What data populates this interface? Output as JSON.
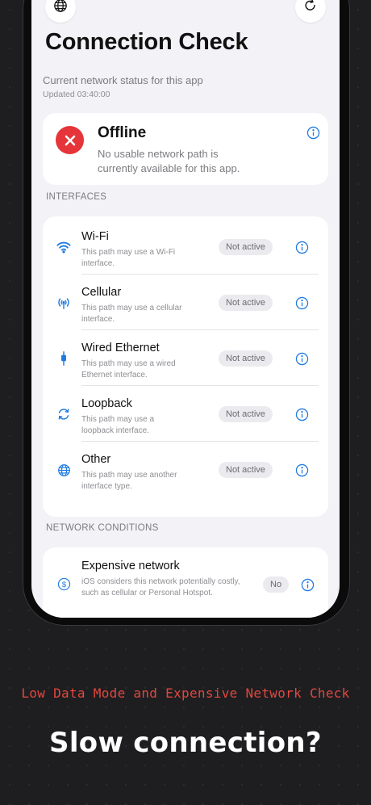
{
  "header": {
    "title": "Connection Check",
    "subtitle": "Current network status for this app",
    "updated": "Updated 03:40:00",
    "left_icon": "globe-icon",
    "right_icon": "refresh-icon"
  },
  "status": {
    "title": "Offline",
    "description": "No usable network path is currently available for this app.",
    "icon": "error-x-icon",
    "color": "#e5343a"
  },
  "interfaces": {
    "section_label": "INTERFACES",
    "items": [
      {
        "name": "Wi-Fi",
        "description": "This path may use a Wi-Fi interface.",
        "status": "Not active",
        "icon": "wifi-icon"
      },
      {
        "name": "Cellular",
        "description": "This path may use a cellular interface.",
        "status": "Not active",
        "icon": "cellular-antenna-icon"
      },
      {
        "name": "Wired Ethernet",
        "description": "This path may use a wired Ethernet interface.",
        "status": "Not active",
        "icon": "ethernet-cable-icon"
      },
      {
        "name": "Loopback",
        "description": "This path may use a loopback interface.",
        "status": "Not active",
        "icon": "loopback-arrows-icon"
      },
      {
        "name": "Other",
        "description": "This path may use another interface type.",
        "status": "Not active",
        "icon": "globe-icon"
      }
    ]
  },
  "conditions": {
    "section_label": "NETWORK CONDITIONS",
    "items": [
      {
        "name": "Expensive network",
        "description": "iOS considers this network potentially costly, such as cellular or Personal Hotspot.",
        "status": "No",
        "icon": "dollar-icon"
      }
    ]
  },
  "promo": {
    "caption": "Low Data Mode and Expensive Network Check",
    "headline": "Slow connection?"
  },
  "colors": {
    "accent": "#1f7ae0",
    "caption": "#e2483d",
    "background": "#1e1e21"
  }
}
